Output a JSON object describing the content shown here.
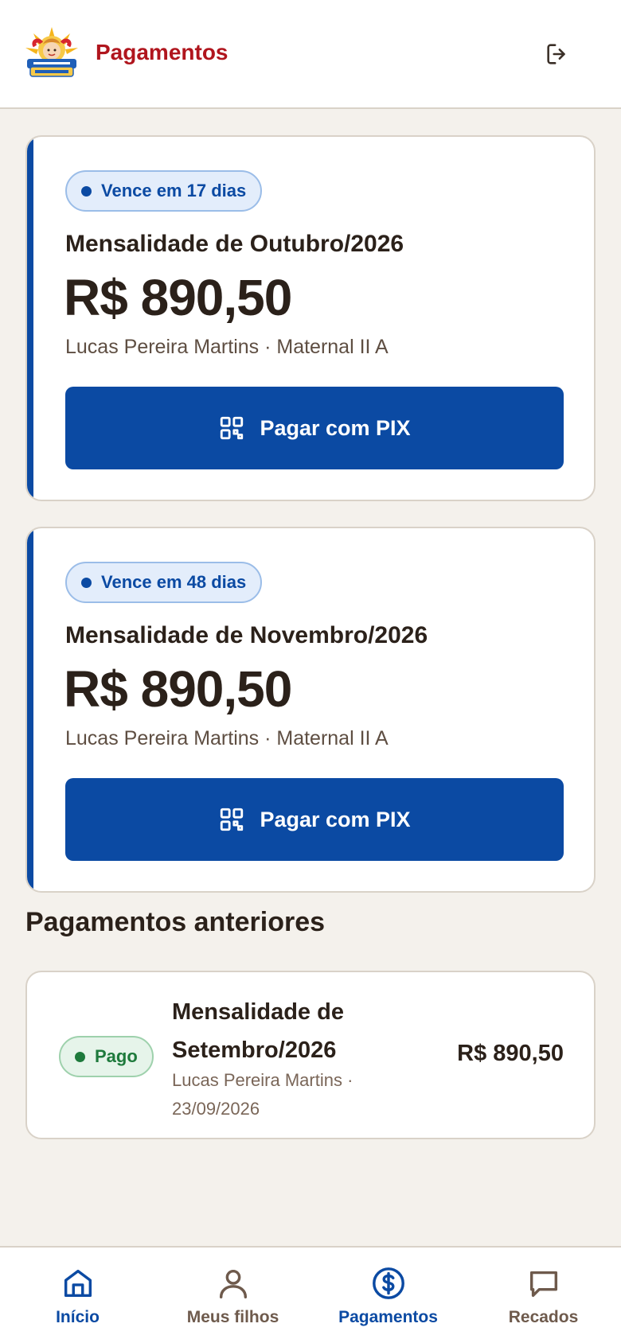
{
  "header": {
    "title": "Pagamentos",
    "logo_icon": "school-logo-icon",
    "logout_icon": "logout-icon"
  },
  "upcoming": [
    {
      "badge": "Vence em 17 dias",
      "title": "Mensalidade de Outubro/2026",
      "amount": "R$ 890,50",
      "subtitle": "Lucas Pereira Martins · Maternal II A",
      "button_label": "Pagar com PIX"
    },
    {
      "badge": "Vence em 48 dias",
      "title": "Mensalidade de Novembro/2026",
      "amount": "R$ 890,50",
      "subtitle": "Lucas Pereira Martins · Maternal II A",
      "button_label": "Pagar com PIX"
    }
  ],
  "history": {
    "section_title": "Pagamentos anteriores",
    "items": [
      {
        "status": "Pago",
        "title": "Mensalidade de Setembro/2026",
        "subtitle": "Lucas Pereira Martins · 23/09/2026",
        "amount": "R$ 890,50"
      }
    ]
  },
  "nav": {
    "items": [
      {
        "label": "Início",
        "icon": "home-icon"
      },
      {
        "label": "Meus filhos",
        "icon": "user-icon"
      },
      {
        "label": "Pagamentos",
        "icon": "dollar-icon"
      },
      {
        "label": "Recados",
        "icon": "message-icon"
      }
    ],
    "active_index": 2
  },
  "colors": {
    "brand_blue": "#0b4aa3",
    "brand_red": "#b0151d",
    "paid_green": "#1e7a3c",
    "background": "#f4f1ec"
  }
}
